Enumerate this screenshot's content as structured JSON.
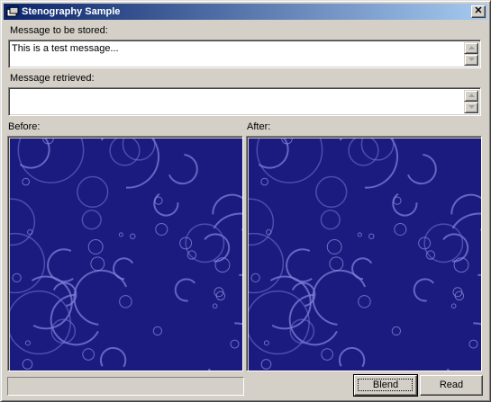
{
  "window": {
    "title": "Stenography Sample",
    "close_glyph": "✕",
    "titlebar_gradient": [
      "#0a246a",
      "#a6caf0"
    ]
  },
  "form": {
    "stored_label": "Message to be stored:",
    "stored_value": "This is a test message...",
    "retrieved_label": "Message retrieved:",
    "retrieved_value": "",
    "before_label": "Before:",
    "after_label": "After:",
    "status_text": ""
  },
  "buttons": {
    "blend_label": "Blend",
    "read_label": "Read"
  },
  "images": {
    "background_color": "#1b1a7e",
    "pattern": "bubbles-and-swirls"
  }
}
